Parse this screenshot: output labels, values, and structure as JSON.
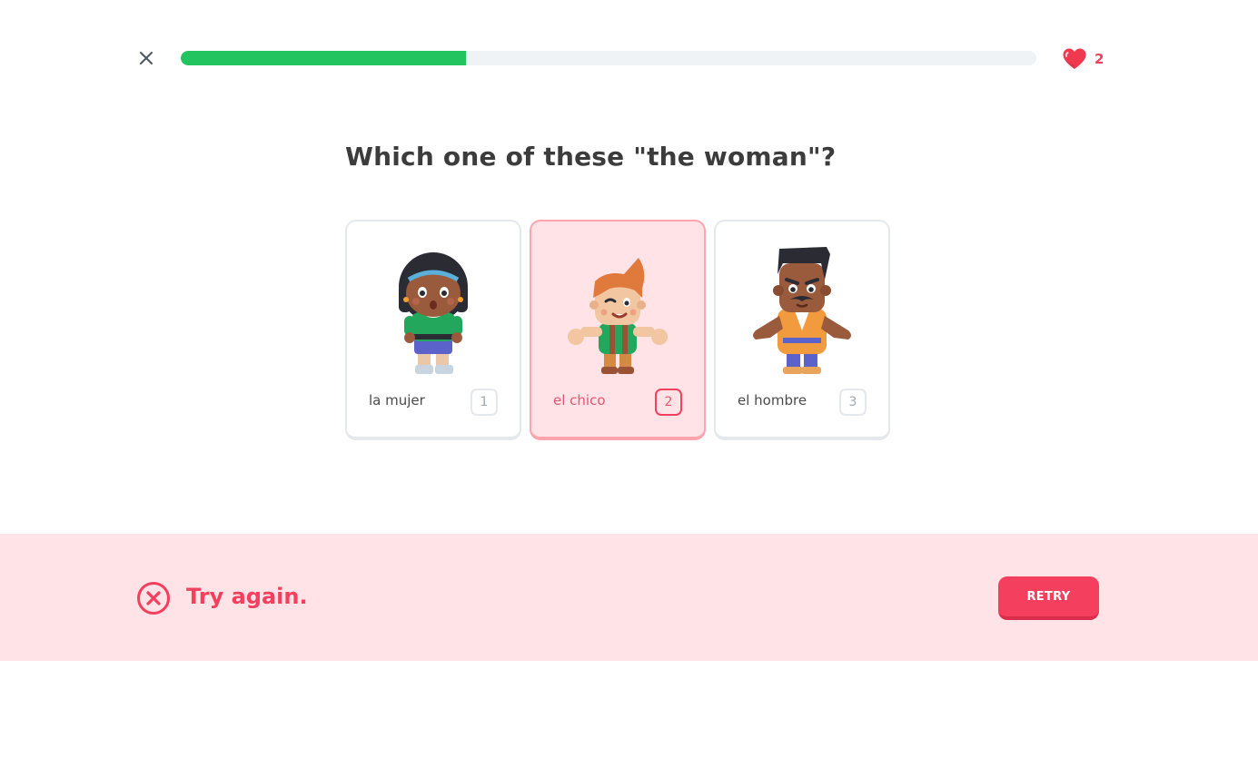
{
  "header": {
    "close_icon": "close-icon",
    "progress": 0.333,
    "progress_color": "#21c45e",
    "hearts_icon": "heart-icon",
    "hearts_count": "2",
    "hearts_color": "#f43f5e"
  },
  "question": {
    "text": "Which one of these \"the woman\"?"
  },
  "choices": [
    {
      "label": "la mujer",
      "key": "1",
      "character": "woman-character",
      "selected": false
    },
    {
      "label": "el chico",
      "key": "2",
      "character": "boy-character",
      "selected": true
    },
    {
      "label": "el hombre",
      "key": "3",
      "character": "man-character",
      "selected": false
    }
  ],
  "feedback": {
    "icon": "error-circle-icon",
    "message": "Try again.",
    "retry_label": "RETRY",
    "background": "#ffe3e6",
    "accent": "#f43f5e"
  }
}
